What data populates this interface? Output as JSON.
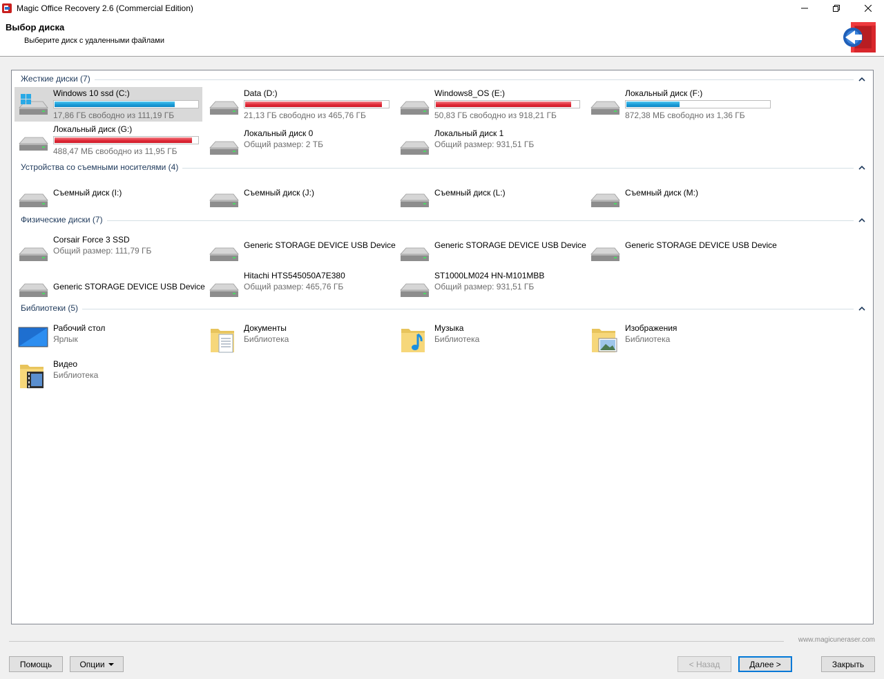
{
  "window": {
    "title": "Magic Office Recovery 2.6 (Commercial Edition)"
  },
  "header": {
    "title": "Выбор диска",
    "subtitle": "Выберите диск с удаленными файлами"
  },
  "groups": {
    "hard": {
      "title": "Жесткие диски (7)",
      "items": [
        {
          "name": "Windows 10 ssd (C:)",
          "sub": "17,86 ГБ свободно из 111,19 ГБ",
          "used": 0.84,
          "color": "blue",
          "selected": true,
          "os": true
        },
        {
          "name": "Data (D:)",
          "sub": "21,13 ГБ свободно из 465,76 ГБ",
          "used": 0.955,
          "color": "red"
        },
        {
          "name": "Windows8_OS (E:)",
          "sub": "50,83 ГБ свободно из 918,21 ГБ",
          "used": 0.945,
          "color": "red"
        },
        {
          "name": "Локальный диск (F:)",
          "sub": "872,38 МБ свободно из 1,36 ГБ",
          "used": 0.37,
          "color": "blue"
        },
        {
          "name": "Локальный диск (G:)",
          "sub": "488,47 МБ свободно из 11,95 ГБ",
          "used": 0.96,
          "color": "red"
        },
        {
          "name": "Локальный диск 0",
          "sub": "Общий размер: 2 ТБ"
        },
        {
          "name": "Локальный диск 1",
          "sub": "Общий размер: 931,51 ГБ"
        }
      ]
    },
    "removable": {
      "title": "Устройства со съемными носителями (4)",
      "items": [
        {
          "name": "Съемный диск (I:)"
        },
        {
          "name": "Съемный диск (J:)"
        },
        {
          "name": "Съемный диск (L:)"
        },
        {
          "name": "Съемный диск (M:)"
        }
      ]
    },
    "physical": {
      "title": "Физические диски (7)",
      "items": [
        {
          "name": "Corsair Force 3 SSD",
          "sub": "Общий размер: 111,79 ГБ"
        },
        {
          "name": "Generic STORAGE DEVICE USB Device"
        },
        {
          "name": "Generic STORAGE DEVICE USB Device"
        },
        {
          "name": "Generic STORAGE DEVICE USB Device"
        },
        {
          "name": "Generic STORAGE DEVICE USB Device"
        },
        {
          "name": "Hitachi HTS545050A7E380",
          "sub": "Общий размер: 465,76 ГБ"
        },
        {
          "name": "ST1000LM024 HN-M101MBB",
          "sub": "Общий размер: 931,51 ГБ"
        }
      ]
    },
    "libraries": {
      "title": "Библиотеки (5)",
      "items": [
        {
          "name": "Рабочий стол",
          "sub": "Ярлык",
          "icon": "desktop-icon"
        },
        {
          "name": "Документы",
          "sub": "Библиотека",
          "icon": "documents-folder-icon"
        },
        {
          "name": "Музыка",
          "sub": "Библиотека",
          "icon": "music-folder-icon"
        },
        {
          "name": "Изображения",
          "sub": "Библиотека",
          "icon": "pictures-folder-icon"
        },
        {
          "name": "Видео",
          "sub": "Библиотека",
          "icon": "video-folder-icon"
        }
      ]
    }
  },
  "footer": {
    "url": "www.magicuneraser.com",
    "help": "Помощь",
    "options": "Опции",
    "back": "< Назад",
    "next": "Далее >",
    "close": "Закрыть"
  },
  "colors": {
    "bar_blue": "#1a9bd7",
    "bar_red": "#e12a38",
    "group_title": "#1e395b",
    "selection": "#d9d9d9"
  }
}
